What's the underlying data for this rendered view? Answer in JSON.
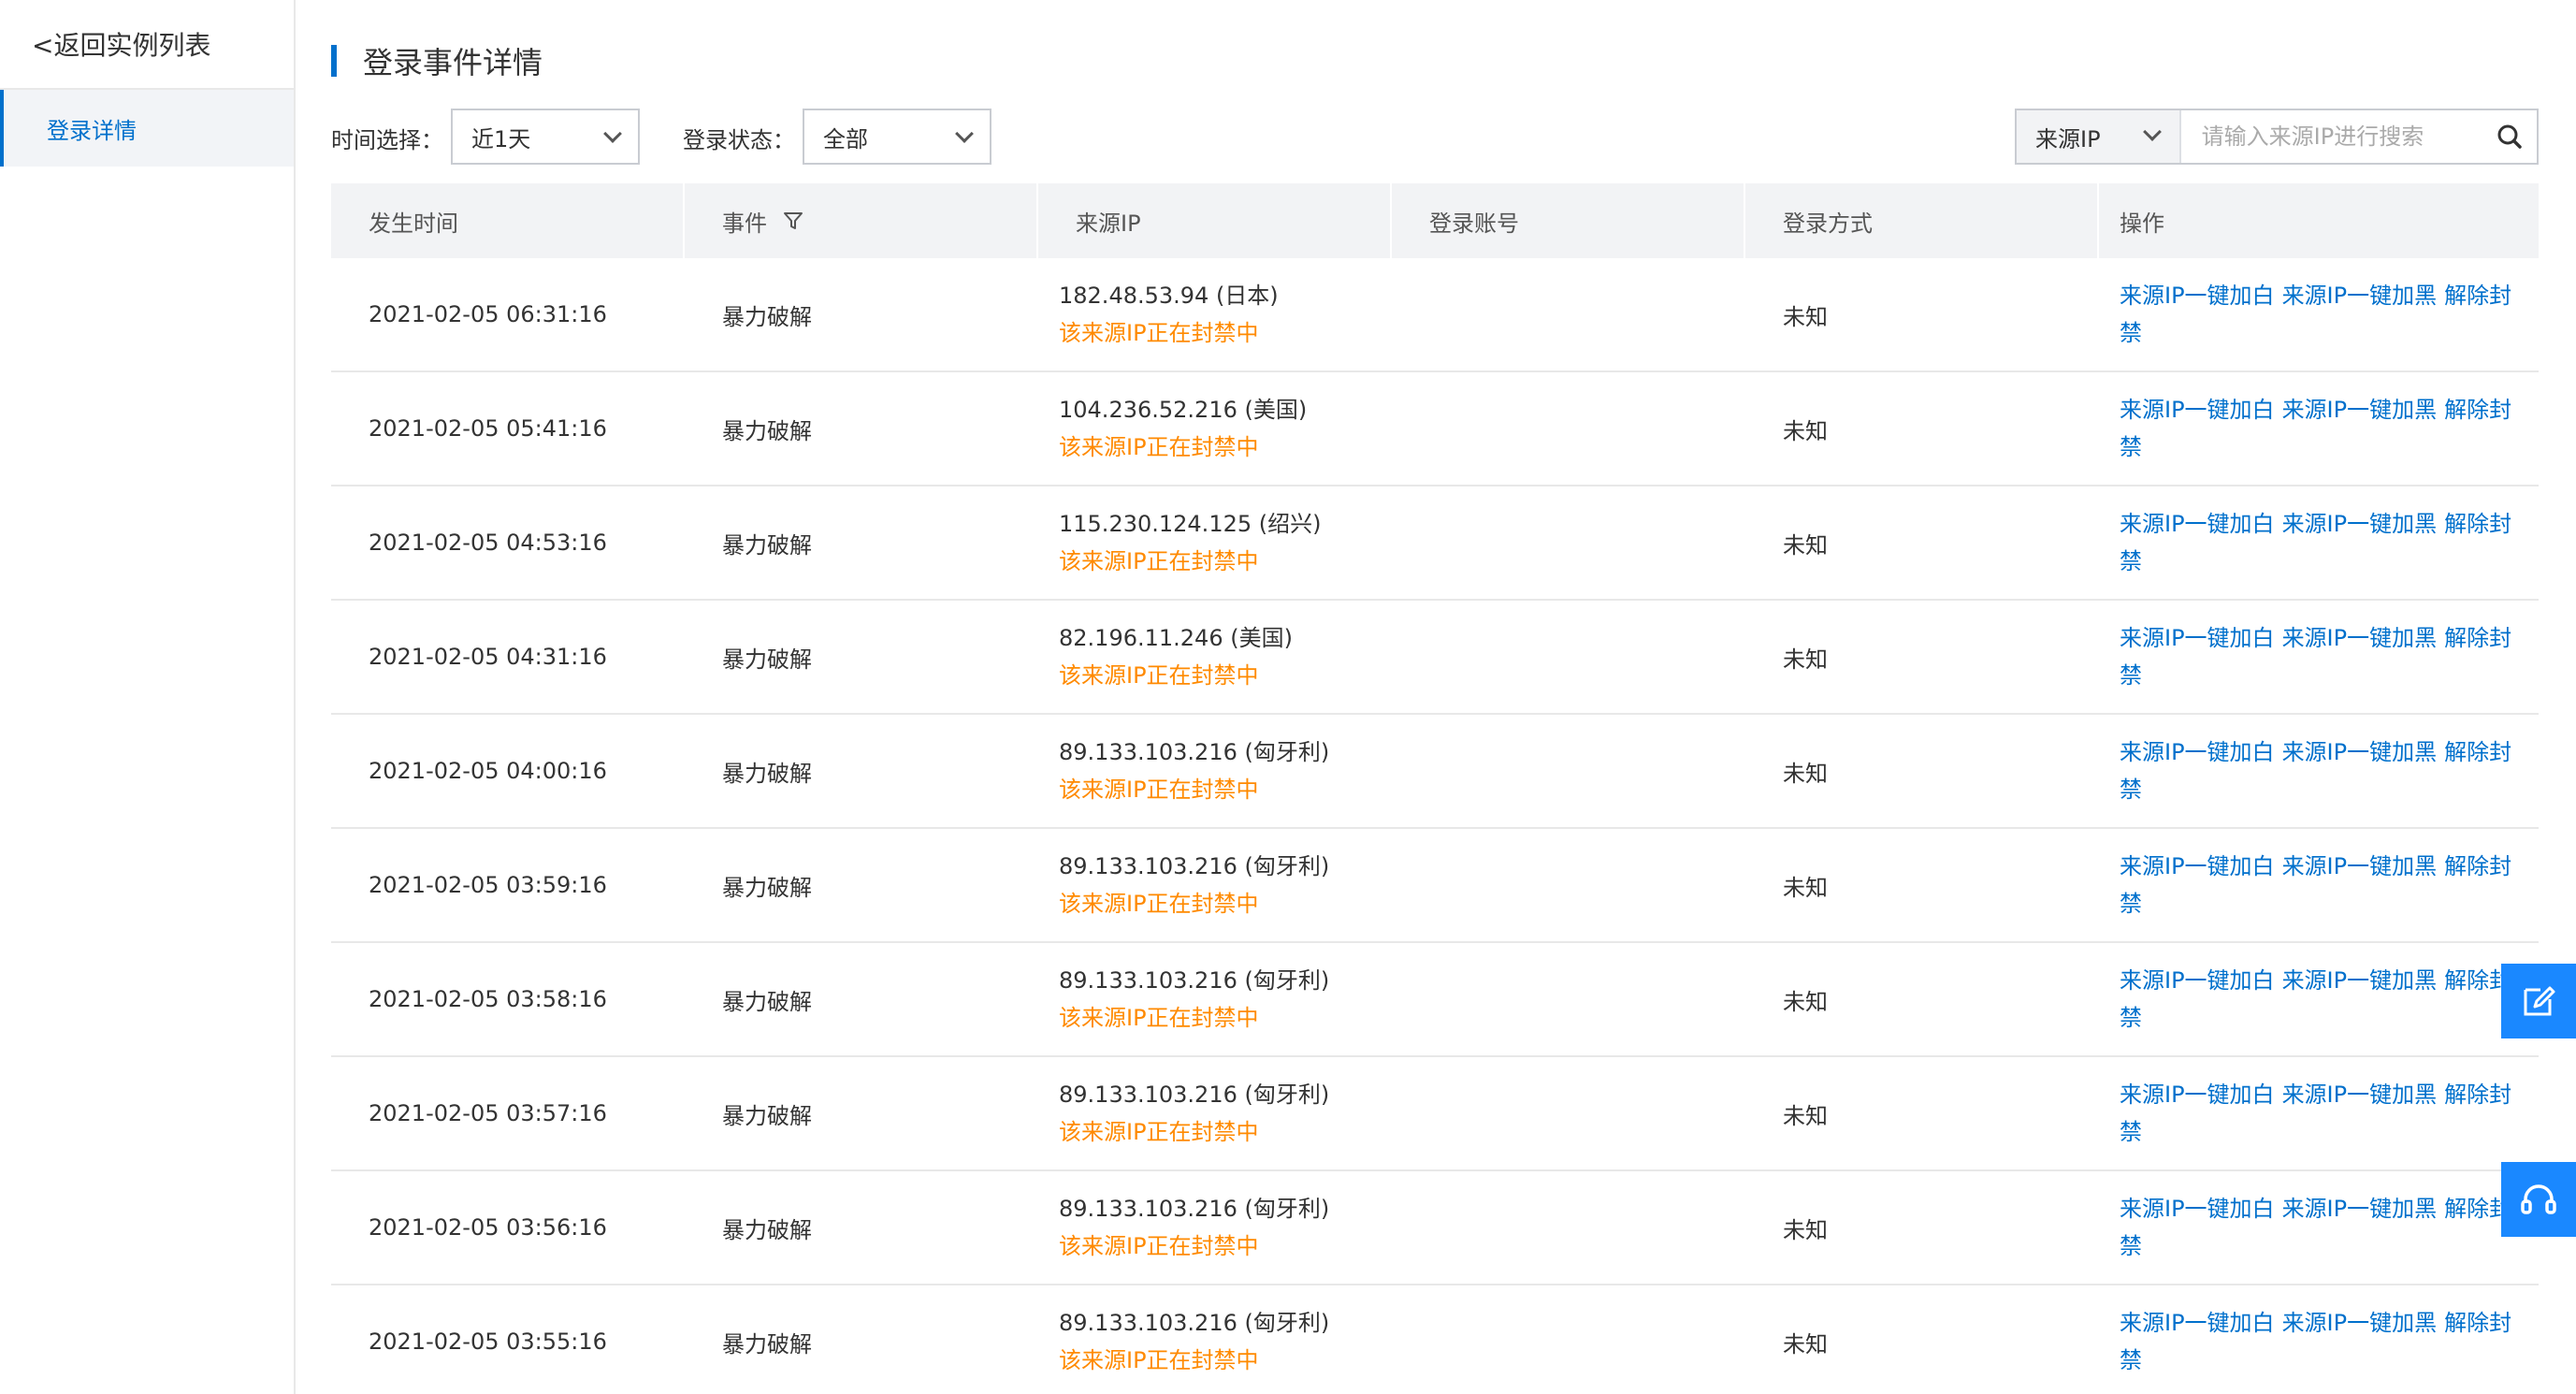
{
  "sidebar": {
    "back_label": "<返回实例列表",
    "items": [
      {
        "label": "登录详情"
      }
    ]
  },
  "header": {
    "title": "登录事件详情"
  },
  "filters": {
    "time_label": "时间选择：",
    "time_value": "近1天",
    "status_label": "登录状态：",
    "status_value": "全部",
    "search_type": "来源IP",
    "search_placeholder": "请输入来源IP进行搜索"
  },
  "table": {
    "columns": [
      "发生时间",
      "事件",
      "来源IP",
      "登录账号",
      "登录方式",
      "操作"
    ],
    "rows": [
      {
        "time": "2021-02-05 06:31:16",
        "event": "暴力破解",
        "ip": "182.48.53.94 (日本)",
        "status": "该来源IP正在封禁中",
        "account": "",
        "method": "未知"
      },
      {
        "time": "2021-02-05 05:41:16",
        "event": "暴力破解",
        "ip": "104.236.52.216 (美国)",
        "status": "该来源IP正在封禁中",
        "account": "",
        "method": "未知"
      },
      {
        "time": "2021-02-05 04:53:16",
        "event": "暴力破解",
        "ip": "115.230.124.125 (绍兴)",
        "status": "该来源IP正在封禁中",
        "account": "",
        "method": "未知"
      },
      {
        "time": "2021-02-05 04:31:16",
        "event": "暴力破解",
        "ip": "82.196.11.246 (美国)",
        "status": "该来源IP正在封禁中",
        "account": "",
        "method": "未知"
      },
      {
        "time": "2021-02-05 04:00:16",
        "event": "暴力破解",
        "ip": "89.133.103.216 (匈牙利)",
        "status": "该来源IP正在封禁中",
        "account": "",
        "method": "未知"
      },
      {
        "time": "2021-02-05 03:59:16",
        "event": "暴力破解",
        "ip": "89.133.103.216 (匈牙利)",
        "status": "该来源IP正在封禁中",
        "account": "",
        "method": "未知"
      },
      {
        "time": "2021-02-05 03:58:16",
        "event": "暴力破解",
        "ip": "89.133.103.216 (匈牙利)",
        "status": "该来源IP正在封禁中",
        "account": "",
        "method": "未知"
      },
      {
        "time": "2021-02-05 03:57:16",
        "event": "暴力破解",
        "ip": "89.133.103.216 (匈牙利)",
        "status": "该来源IP正在封禁中",
        "account": "",
        "method": "未知"
      },
      {
        "time": "2021-02-05 03:56:16",
        "event": "暴力破解",
        "ip": "89.133.103.216 (匈牙利)",
        "status": "该来源IP正在封禁中",
        "account": "",
        "method": "未知"
      },
      {
        "time": "2021-02-05 03:55:16",
        "event": "暴力破解",
        "ip": "89.133.103.216 (匈牙利)",
        "status": "该来源IP正在封禁中",
        "account": "",
        "method": "未知"
      }
    ],
    "actions": {
      "whitelist": "来源IP一键加白",
      "blacklist": "来源IP一键加黑",
      "unban": "解除封禁"
    }
  },
  "floating": {
    "icons": [
      "edit-icon",
      "headset-icon"
    ]
  },
  "colors": {
    "accent": "#0070cc",
    "warning": "#ff8a00",
    "float_button": "#1a88ff"
  }
}
